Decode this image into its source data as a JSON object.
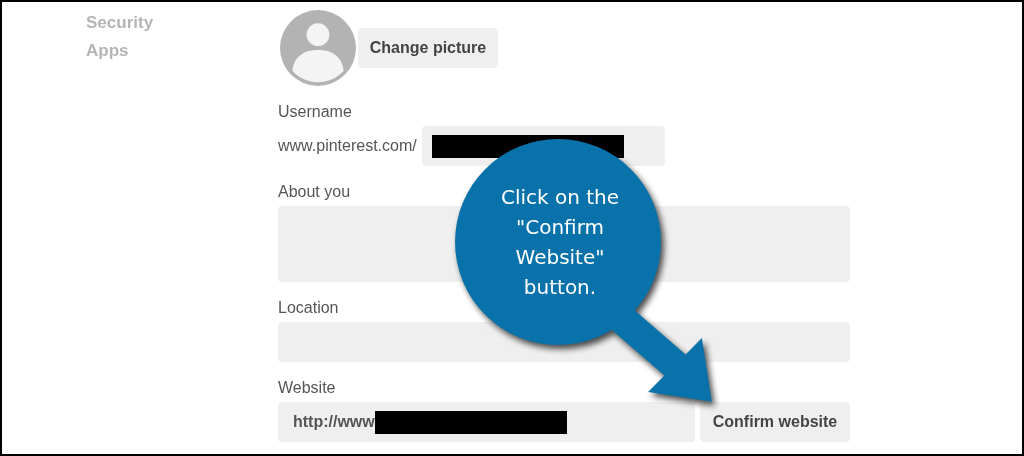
{
  "sidebar": {
    "items": [
      {
        "label": "Security"
      },
      {
        "label": "Apps"
      }
    ]
  },
  "profile": {
    "change_picture": "Change picture"
  },
  "username": {
    "label": "Username",
    "prefix": "www.pinterest.com/",
    "redacted": true
  },
  "about": {
    "label": "About you"
  },
  "location": {
    "label": "Location"
  },
  "website": {
    "label": "Website",
    "value": "http://www",
    "redacted": true,
    "button": "Confirm website"
  },
  "callout": {
    "text": "Click on the \"Confirm Website\" button."
  }
}
